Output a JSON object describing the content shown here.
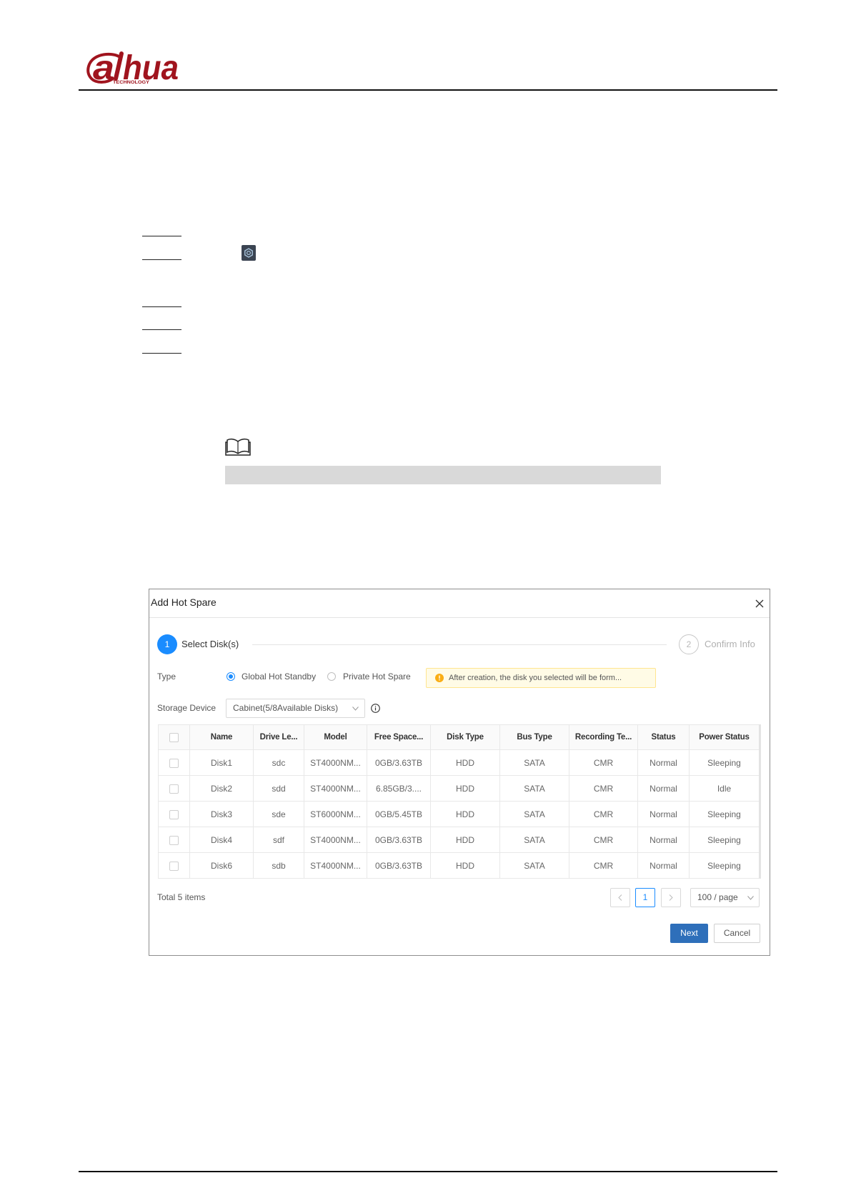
{
  "logo": {
    "mark": "a",
    "wordmark": "hua",
    "tagline": "TECHNOLOGY"
  },
  "colors": {
    "brand": "#a0141e",
    "accent": "#1a8cff",
    "primary_button": "#2e6fba",
    "warning_icon": "#faad14",
    "warning_bg": "#fffbe6",
    "warning_border": "#ffe58f"
  },
  "icons": {
    "settings": "gear-icon",
    "note": "book-icon"
  },
  "dialog": {
    "title": "Add Hot Spare",
    "close_icon": "close-icon",
    "steps": [
      {
        "number": "1",
        "label": "Select Disk(s)",
        "active": true
      },
      {
        "number": "2",
        "label": "Confirm Info",
        "active": false
      }
    ],
    "type": {
      "label": "Type",
      "options": [
        {
          "label": "Global Hot Standby",
          "checked": true
        },
        {
          "label": "Private Hot Spare",
          "checked": false
        }
      ]
    },
    "warning": {
      "icon": "warning-dot-icon",
      "text": "After creation, the disk you selected will be form..."
    },
    "storage_device": {
      "label": "Storage Device",
      "value": "Cabinet(5/8Available Disks)",
      "dropdown_icon": "chevron-down-icon",
      "info_icon": "info-icon"
    },
    "table": {
      "select_all": false,
      "columns": [
        "Name",
        "Drive Le...",
        "Model",
        "Free Space...",
        "Disk Type",
        "Bus Type",
        "Recording Te...",
        "Status",
        "Power Status"
      ],
      "rows": [
        {
          "checked": false,
          "name": "Disk1",
          "drive_letter": "sdc",
          "model": "ST4000NM...",
          "free_space": "0GB/3.63TB",
          "disk_type": "HDD",
          "bus_type": "SATA",
          "recording": "CMR",
          "status": "Normal",
          "power_status": "Sleeping"
        },
        {
          "checked": false,
          "name": "Disk2",
          "drive_letter": "sdd",
          "model": "ST4000NM...",
          "free_space": "6.85GB/3....",
          "disk_type": "HDD",
          "bus_type": "SATA",
          "recording": "CMR",
          "status": "Normal",
          "power_status": "Idle"
        },
        {
          "checked": false,
          "name": "Disk3",
          "drive_letter": "sde",
          "model": "ST6000NM...",
          "free_space": "0GB/5.45TB",
          "disk_type": "HDD",
          "bus_type": "SATA",
          "recording": "CMR",
          "status": "Normal",
          "power_status": "Sleeping"
        },
        {
          "checked": false,
          "name": "Disk4",
          "drive_letter": "sdf",
          "model": "ST4000NM...",
          "free_space": "0GB/3.63TB",
          "disk_type": "HDD",
          "bus_type": "SATA",
          "recording": "CMR",
          "status": "Normal",
          "power_status": "Sleeping"
        },
        {
          "checked": false,
          "name": "Disk6",
          "drive_letter": "sdb",
          "model": "ST4000NM...",
          "free_space": "0GB/3.63TB",
          "disk_type": "HDD",
          "bus_type": "SATA",
          "recording": "CMR",
          "status": "Normal",
          "power_status": "Sleeping"
        }
      ]
    },
    "total": "Total 5 items",
    "pagination": {
      "prev_icon": "chevron-left-icon",
      "current_page": "1",
      "next_icon": "chevron-right-icon",
      "page_size": "100 / page",
      "page_size_icon": "chevron-down-icon"
    },
    "buttons": {
      "next": "Next",
      "cancel": "Cancel"
    }
  }
}
